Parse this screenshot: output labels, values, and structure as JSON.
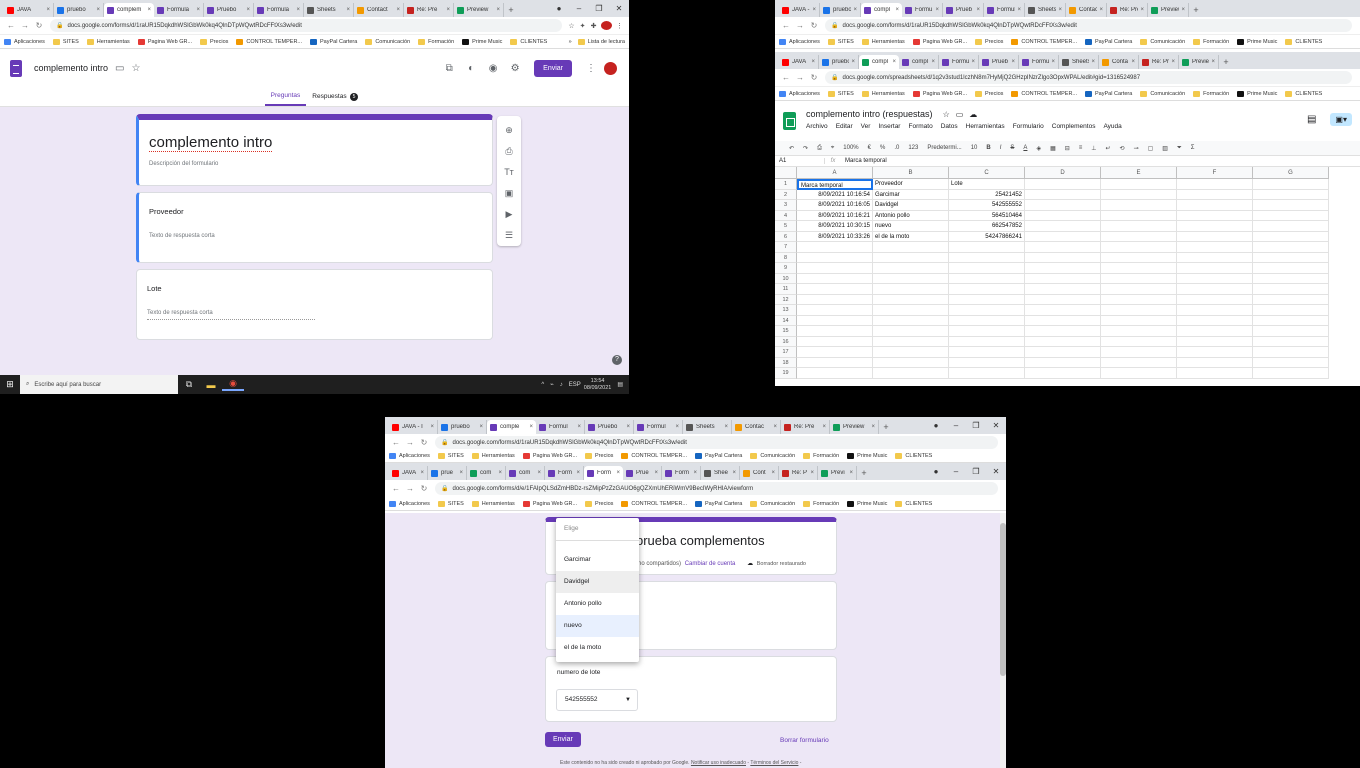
{
  "editor_window": {
    "tabs": [
      {
        "label": "JAVA",
        "color": "#ff0000"
      },
      {
        "label": "pruebo",
        "color": "#1a73e8"
      },
      {
        "label": "complem",
        "color": "#673ab7",
        "active": true
      },
      {
        "label": "Formula",
        "color": "#673ab7"
      },
      {
        "label": "Pruebo",
        "color": "#673ab7"
      },
      {
        "label": "Formula",
        "color": "#673ab7"
      },
      {
        "label": "Sheets",
        "color": "#555555"
      },
      {
        "label": "Contact",
        "color": "#f29900"
      },
      {
        "label": "Re: Pre",
        "color": "#c5221f"
      },
      {
        "label": "Preview",
        "color": "#0f9d58"
      }
    ],
    "url": "docs.google.com/forms/d/1raUR15DqkdhWSlGbWk0kq4QlnDTpWQwtRDcFFtXs3w/edit",
    "bookmarks": [
      "Aplicaciones",
      "SITES",
      "Herramientas",
      "Pagina Web GR...",
      "Precios",
      "CONTROL TEMPER...",
      "PayPal Cartera",
      "Comunicación",
      "Formación",
      "Prime Music",
      "CLIENTES"
    ],
    "bookmarks_more": "»",
    "reading_list": "Lista de lectura",
    "form_title_header": "complemento intro",
    "send_label": "Enviar",
    "tab_questions": "Preguntas",
    "tab_responses": "Respuestas",
    "responses_count": "5",
    "form_title": "complemento intro",
    "form_description": "Descripción del formulario",
    "questions": [
      {
        "label": "Proveedor",
        "hint": "Texto de respuesta corta"
      },
      {
        "label": "Lote",
        "hint": "Texto de respuesta corta"
      }
    ]
  },
  "taskbar": {
    "search_placeholder": "Escribe aquí para buscar",
    "lang": "ESP",
    "time": "13:54",
    "date": "08/09/2021"
  },
  "sheets_window": {
    "tabs_top": [
      {
        "label": "JAVA - I",
        "color": "#ff0000"
      },
      {
        "label": "pruebo",
        "color": "#1a73e8"
      },
      {
        "label": "compl",
        "color": "#673ab7",
        "active": true
      },
      {
        "label": "Formu",
        "color": "#673ab7"
      },
      {
        "label": "Prueb",
        "color": "#673ab7"
      },
      {
        "label": "Formul",
        "color": "#673ab7"
      },
      {
        "label": "Sheets",
        "color": "#555555"
      },
      {
        "label": "Contac",
        "color": "#f29900"
      },
      {
        "label": "Re: Pre",
        "color": "#c5221f"
      },
      {
        "label": "Preview",
        "color": "#0f9d58"
      }
    ],
    "url_top": "docs.google.com/forms/d/1raUR15DqkdhWSlGbWk0kq4QlnDTpWQwtRDcFFtXs3w/edit",
    "tabs": [
      {
        "label": "JAVA",
        "color": "#ff0000"
      },
      {
        "label": "pruebo",
        "color": "#1a73e8"
      },
      {
        "label": "compl",
        "color": "#0f9d58",
        "active": true
      },
      {
        "label": "compl",
        "color": "#673ab7"
      },
      {
        "label": "Formu",
        "color": "#673ab7"
      },
      {
        "label": "Prueb",
        "color": "#673ab7"
      },
      {
        "label": "Formu",
        "color": "#673ab7"
      },
      {
        "label": "Sheets",
        "color": "#555555"
      },
      {
        "label": "Conta",
        "color": "#f29900"
      },
      {
        "label": "Re: Pr",
        "color": "#c5221f"
      },
      {
        "label": "Previe",
        "color": "#0f9d58"
      }
    ],
    "url": "docs.google.com/spreadsheets/d/1q2v3stud1lczhN8m7HyMjQ2GHzpINzrZlgo3OpxWPAL/edit#gid=1316524987",
    "title": "complemento intro (respuestas)",
    "menu": [
      "Archivo",
      "Editar",
      "Ver",
      "Insertar",
      "Formato",
      "Datos",
      "Herramientas",
      "Formulario",
      "Complementos",
      "Ayuda"
    ],
    "zoom": "100%",
    "font": "Predetermi...",
    "font_size": "10",
    "cell_ref": "A1",
    "formula": "Marca temporal",
    "columns": [
      "A",
      "B",
      "C",
      "D",
      "E",
      "F",
      "G"
    ],
    "rows": [
      [
        "Marca temporal",
        "Proveedor",
        "Lote"
      ],
      [
        "8/09/2021 10:16:54",
        "Garcimar",
        "25421452"
      ],
      [
        "8/09/2021 10:16:05",
        "Davidgel",
        "542555552"
      ],
      [
        "8/09/2021 10:16:21",
        "Antonio pollo",
        "564510464"
      ],
      [
        "8/09/2021 10:30:15",
        "nuevo",
        "662547852"
      ],
      [
        "8/09/2021 10:33:26",
        "el de la moto",
        "54247866241"
      ]
    ],
    "row_numbers": [
      "1",
      "2",
      "3",
      "4",
      "5",
      "6",
      "7",
      "8",
      "9",
      "10",
      "11",
      "12",
      "13",
      "14",
      "15",
      "16",
      "17",
      "18",
      "19"
    ]
  },
  "preview_window": {
    "tabs_top": [
      {
        "label": "JAVA - I",
        "color": "#ff0000"
      },
      {
        "label": "pruebo",
        "color": "#1a73e8"
      },
      {
        "label": "comple",
        "color": "#673ab7",
        "active": true
      },
      {
        "label": "Formul",
        "color": "#673ab7"
      },
      {
        "label": "Pruebo",
        "color": "#673ab7"
      },
      {
        "label": "Formul",
        "color": "#673ab7"
      },
      {
        "label": "Sheets",
        "color": "#555555"
      },
      {
        "label": "Contac",
        "color": "#f29900"
      },
      {
        "label": "Re: Pre",
        "color": "#c5221f"
      },
      {
        "label": "Preview",
        "color": "#0f9d58"
      }
    ],
    "url_top": "docs.google.com/forms/d/1raUR15DqkdhWSlGbWk0kq4QlnDTpWQwtRDcFFtXs3w/edit",
    "tabs": [
      {
        "label": "JAVA",
        "color": "#ff0000"
      },
      {
        "label": "prue",
        "color": "#1a73e8"
      },
      {
        "label": "com",
        "color": "#0f9d58"
      },
      {
        "label": "com",
        "color": "#673ab7"
      },
      {
        "label": "Form",
        "color": "#673ab7"
      },
      {
        "label": "Form",
        "color": "#673ab7",
        "active": true
      },
      {
        "label": "Prue",
        "color": "#673ab7"
      },
      {
        "label": "Form",
        "color": "#673ab7"
      },
      {
        "label": "Shee",
        "color": "#555555"
      },
      {
        "label": "Cont",
        "color": "#f29900"
      },
      {
        "label": "Re: P",
        "color": "#c5221f"
      },
      {
        "label": "Previ",
        "color": "#0f9d58"
      }
    ],
    "url": "docs.google.com/forms/d/e/1FAIpQLSdZmHBDz-rsZMipPzZzGAUO6gQZXmUhERiWmV9BecIWyRHIA/viewform",
    "form_title": "prueba complementos",
    "account_note": "(no compartidos)",
    "switch_account": "Cambiar de cuenta",
    "draft_saved": "Borrador restaurado",
    "dropdown_placeholder": "Elige",
    "dropdown_options": [
      "Garcimar",
      "Davidgel",
      "Antonio pollo",
      "nuevo",
      "el de la moto"
    ],
    "lot_question": "numero de lote",
    "lot_selected": "542555552",
    "submit_label": "Enviar",
    "clear_label": "Borrar formulario",
    "footnote": "Este contenido no ha sido creado ni aprobado por Google.",
    "report_link": "Notificar uso inadecuado",
    "terms_link": "Términos del Servicio"
  }
}
